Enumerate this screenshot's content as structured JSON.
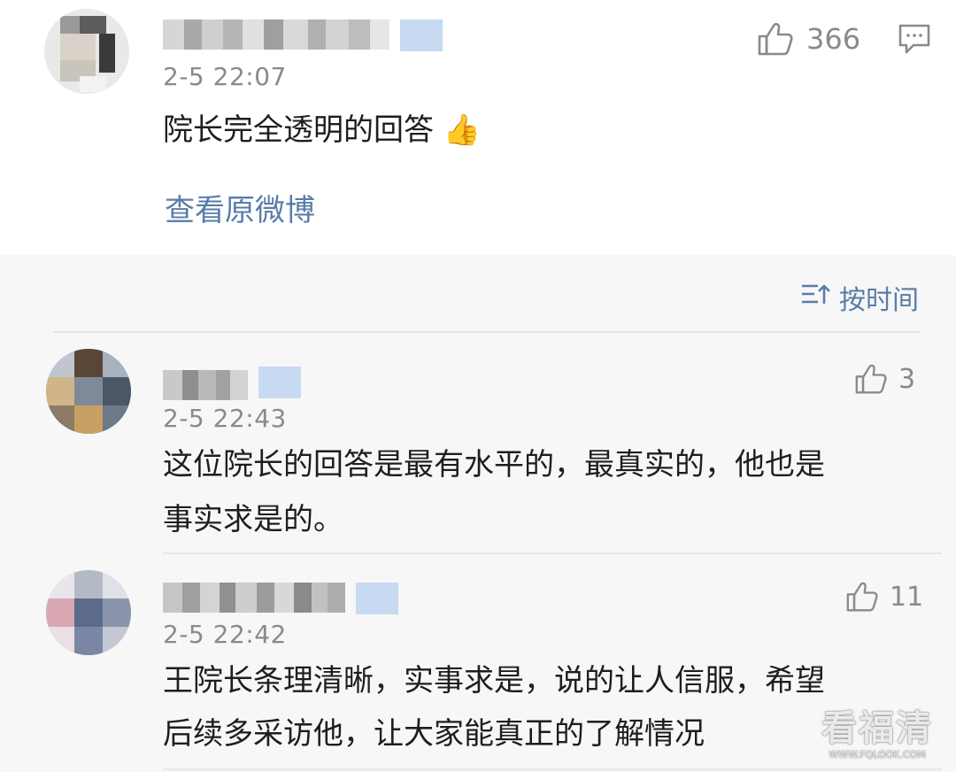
{
  "main_post": {
    "time": "2-5 22:07",
    "likes": "366",
    "content": "院长完全透明的回答 👍",
    "view_original_label": "查看原微博",
    "comment_icon": "comment-icon",
    "like_icon": "thumbs-up-icon"
  },
  "reply_section": {
    "sort_label": "按时间",
    "sort_icon": "sort-icon",
    "comments": [
      {
        "time": "2-5 22:43",
        "likes": "3",
        "line1": "这位院长的回答是最有水平的，最真实的，他也是",
        "line2": "事实求是的。"
      },
      {
        "time": "2-5 22:42",
        "likes": "11",
        "line1": "王院长条理清晰，实事求是，说的让人信服，希望",
        "line2": "后续多采访他，让大家能真正的了解情况"
      }
    ]
  },
  "watermark": {
    "main": "看福清",
    "sub": "WWW.FQLOOK.COM"
  },
  "colors": {
    "link": "#5a7ca8",
    "muted": "#8a8a8a",
    "reply_background": "#f7f7f7",
    "vip_badge": "#c7daf2"
  }
}
